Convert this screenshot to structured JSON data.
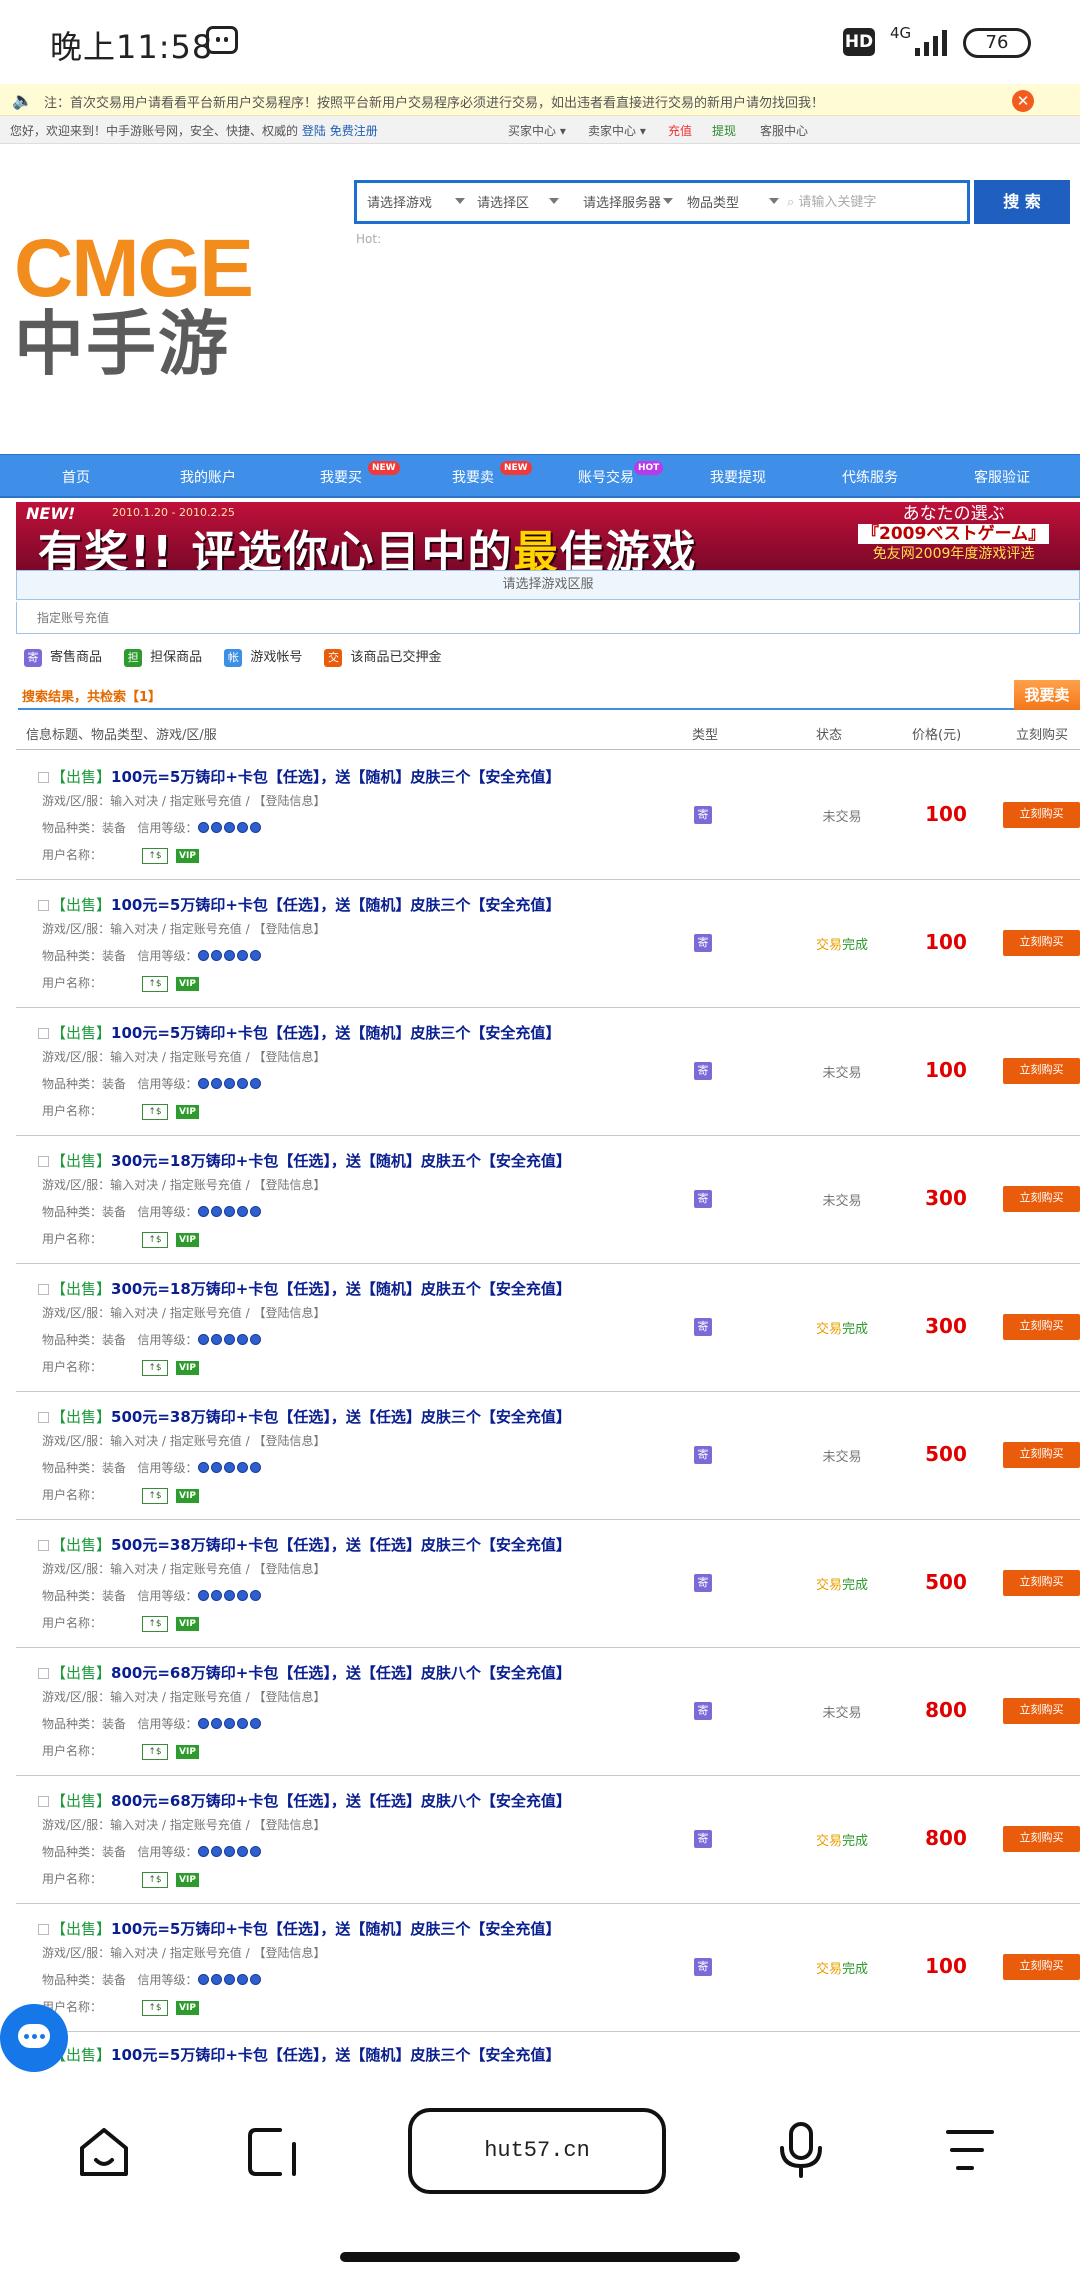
{
  "status_bar": {
    "time": "晚上11:58",
    "hd": "HD",
    "network": "4G",
    "battery": "76"
  },
  "notice": {
    "icon": "speaker-icon",
    "text": "注：首次交易用户请看看平台新用户交易程序！按照平台新用户交易程序必须进行交易，如出违者看直接进行交易的新用户请勿找回我！",
    "close": "✕"
  },
  "topbar": {
    "welcome": "您好，欢迎来到！中手游账号网，安全、快捷、权威的",
    "login": "登陆",
    "register": "免费注册",
    "buyer_center": "买家中心",
    "seller_center": "卖家中心",
    "recharge": "充值",
    "withdraw": "提现",
    "service": "客服中心"
  },
  "search": {
    "selects": [
      "请选择游戏",
      "请选择区",
      "请选择服务器",
      "物品类型"
    ],
    "placeholder": "请输入关键字",
    "button": "搜 索",
    "hot": "Hot:"
  },
  "logo": {
    "top": "CMGE",
    "bottom": "中手游"
  },
  "nav": {
    "items": [
      "首页",
      "我的账户",
      "我要买",
      "我要卖",
      "账号交易",
      "我要提现",
      "代练服务",
      "客服验证"
    ],
    "badges": {
      "buy": "NEW",
      "sell": "NEW",
      "trade": "HOT"
    }
  },
  "banner": {
    "new": "NEW!",
    "date": "2010.1.20 - 2010.2.25",
    "main_pre": "有奖!! 评选你心目中的",
    "main_hl": "最",
    "main_post": "佳游戏",
    "right1": "あなたの選ぶ",
    "right2": "『2009ベストゲーム』",
    "right3": "免友网2009年度游戏评选"
  },
  "region": {
    "label": "请选择游戏区服",
    "recharge": "指定账号充值"
  },
  "legend": [
    {
      "icon": "寄",
      "label": "寄售商品",
      "color": "#7c6ad6"
    },
    {
      "icon": "担",
      "label": "担保商品",
      "color": "#2c9a2c"
    },
    {
      "icon": "帐",
      "label": "游戏帐号",
      "color": "#3d8fe5"
    },
    {
      "icon": "交",
      "label": "该商品已交押金",
      "color": "#e85c0c"
    }
  ],
  "results": {
    "title": "搜索结果，共检索【1】",
    "sell_button": "我要卖"
  },
  "columns": {
    "info": "信息标题、物品类型、游戏/区/服",
    "type": "类型",
    "status": "状态",
    "price": "价格(元)",
    "buy": "立刻购买"
  },
  "listing_labels": {
    "game_prefix": "游戏/区/服：",
    "game_value": "输入对决 / 指定账号充值 / 【登陆信息】",
    "item_prefix": "物品种类：",
    "item_value": "装备",
    "credit": "信用等级：",
    "user": "用户名称：",
    "vip": "VIP",
    "type_icon": "寄",
    "buy": "立刻购买"
  },
  "listings": [
    {
      "tag": "【出售】",
      "title": "100元=5万铸印+卡包【任选】，送【随机】皮肤三个【安全充值】",
      "status_plain": "未交易",
      "status_a": "",
      "status_b": "",
      "price": "100"
    },
    {
      "tag": "【出售】",
      "title": "100元=5万铸印+卡包【任选】，送【随机】皮肤三个【安全充值】",
      "status_plain": "",
      "status_a": "交易",
      "status_b": "完成",
      "price": "100"
    },
    {
      "tag": "【出售】",
      "title": "100元=5万铸印+卡包【任选】，送【随机】皮肤三个【安全充值】",
      "status_plain": "未交易",
      "status_a": "",
      "status_b": "",
      "price": "100"
    },
    {
      "tag": "【出售】",
      "title": "300元=18万铸印+卡包【任选】，送【随机】皮肤五个【安全充值】",
      "status_plain": "未交易",
      "status_a": "",
      "status_b": "",
      "price": "300"
    },
    {
      "tag": "【出售】",
      "title": "300元=18万铸印+卡包【任选】，送【随机】皮肤五个【安全充值】",
      "status_plain": "",
      "status_a": "交易",
      "status_b": "完成",
      "price": "300"
    },
    {
      "tag": "【出售】",
      "title": "500元=38万铸印+卡包【任选】，送【任选】皮肤三个【安全充值】",
      "status_plain": "未交易",
      "status_a": "",
      "status_b": "",
      "price": "500"
    },
    {
      "tag": "【出售】",
      "title": "500元=38万铸印+卡包【任选】，送【任选】皮肤三个【安全充值】",
      "status_plain": "",
      "status_a": "交易",
      "status_b": "完成",
      "price": "500"
    },
    {
      "tag": "【出售】",
      "title": "800元=68万铸印+卡包【任选】，送【任选】皮肤八个【安全充值】",
      "status_plain": "未交易",
      "status_a": "",
      "status_b": "",
      "price": "800"
    },
    {
      "tag": "【出售】",
      "title": "800元=68万铸印+卡包【任选】，送【任选】皮肤八个【安全充值】",
      "status_plain": "",
      "status_a": "交易",
      "status_b": "完成",
      "price": "800"
    },
    {
      "tag": "【出售】",
      "title": "100元=5万铸印+卡包【任选】，送【随机】皮肤三个【安全充值】",
      "status_plain": "",
      "status_a": "交易",
      "status_b": "完成",
      "price": "100"
    }
  ],
  "partial_listing": {
    "tag": "【出售】",
    "title": "100元=5万铸印+卡包【任选】，送【随机】皮肤三个【安全充值】"
  },
  "browser": {
    "url": "hut57.cn"
  }
}
